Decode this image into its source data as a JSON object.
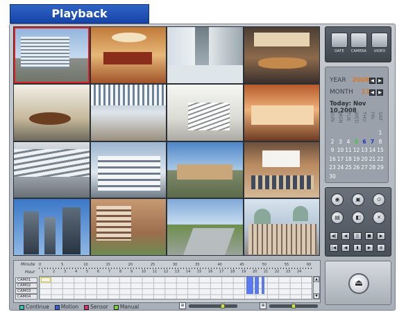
{
  "header": {
    "title": "Playback"
  },
  "toolbar_top": [
    {
      "name": "date-tool",
      "label": "DATE"
    },
    {
      "name": "camera-tool",
      "label": "CAMERA"
    },
    {
      "name": "video-tool",
      "label": "VIDEO"
    }
  ],
  "calendar": {
    "year_label": "YEAR",
    "year_value": "2008",
    "month_label": "MONTH",
    "month_value": "11",
    "today_text": "Today: Nov 10,2008",
    "weekdays": [
      "SUN",
      "MON",
      "TUE",
      "WED",
      "THU",
      "FRI",
      "SAT"
    ],
    "days": [
      "1",
      "2",
      "3",
      "4",
      "5",
      "6",
      "7",
      "8",
      "9",
      "10",
      "11",
      "12",
      "13",
      "14",
      "15",
      "16",
      "17",
      "18",
      "19",
      "20",
      "21",
      "22",
      "23",
      "24",
      "25",
      "26",
      "27",
      "28",
      "29",
      "30"
    ],
    "highlight_day": "5",
    "selected_days": [
      "6",
      "7"
    ]
  },
  "timeline": {
    "minute_label": "Minute",
    "hour_label": "Hour",
    "minute_ticks": [
      "0",
      "5",
      "10",
      "15",
      "20",
      "25",
      "30",
      "35",
      "40",
      "45",
      "50",
      "55",
      "60"
    ],
    "hour_ticks": [
      "1",
      "2",
      "3",
      "4",
      "5",
      "6",
      "7",
      "8",
      "9",
      "10",
      "11",
      "12",
      "13",
      "14",
      "15",
      "16",
      "17",
      "18",
      "19",
      "20",
      "21",
      "22",
      "23",
      "24"
    ],
    "cameras": [
      "CAM01",
      "CAM02",
      "CAM03",
      "CAM04"
    ]
  },
  "legend": [
    {
      "label": "Continue",
      "color": "#2ec4b6"
    },
    {
      "label": "Motion",
      "color": "#3a5ce0"
    },
    {
      "label": "Sensor",
      "color": "#d9306b"
    },
    {
      "label": "Manual",
      "color": "#7ad33a"
    }
  ],
  "colors": {
    "title_bg": "#1644a8",
    "recording": "#5a78f0",
    "select": "#e02020"
  },
  "zoom_slider_1": 0.72,
  "zoom_slider_2": 0.5
}
